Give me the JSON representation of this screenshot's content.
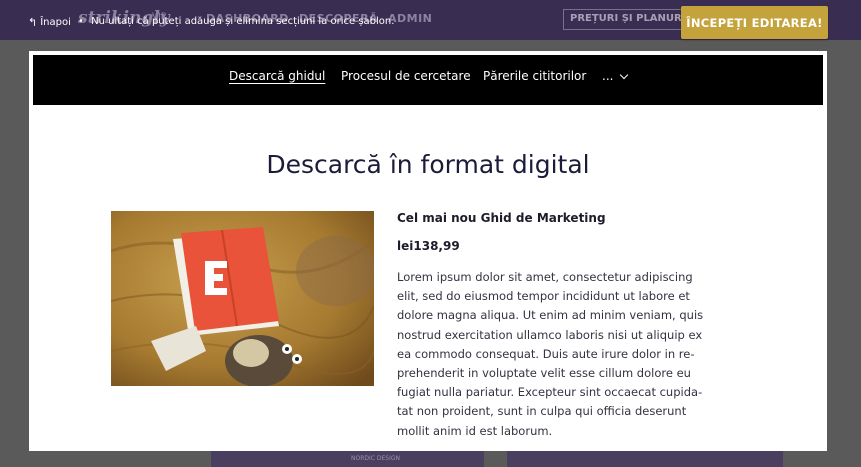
{
  "background": {
    "logo": "strikingly",
    "vip_badge": "VIP",
    "nav": [
      "DASHBOARD",
      "DESCOPERĂ",
      "ADMIN"
    ],
    "pricing_label": "PREȚURI ȘI PLANURI",
    "card_caption": "NORDIC DESIGN"
  },
  "editor_bar": {
    "back_label": "Înapoi",
    "separator": "•",
    "hint": "Nu uitați că puteți adăuga și elimina secțiuni la orice șablon.",
    "start_button": "ÎNCEPEȚI EDITAREA!"
  },
  "preview": {
    "nav": {
      "items": [
        "Descarcă ghidul",
        "Procesul de cercetare",
        "Părerile cititorilor",
        "..."
      ]
    },
    "section_title": "Descarcă în format digital",
    "product": {
      "title": "Cel mai nou Ghid de Marketing",
      "price": "lei138,99",
      "description": "Lorem ipsum dolor sit amet, consectetur adipiscing elit, sed do eiusmod tempor incididunt ut labore et dolore magna aliqua. Ut enim ad minim veniam, quis nostrud exercitation ullamco laboris nisi ut aliquip ex ea commodo consequat. Duis aute irure dolor in re-prehenderit in voluptate velit esse cillum dolore eu fugiat nulla pariatur. Excepteur sint occaecat cupida-tat non proident, sunt in culpa qui officia deserunt mollit anim id est laborum.",
      "book_letter": "E"
    }
  },
  "colors": {
    "accent_button": "#c5a33c",
    "topbar": "#3a2d52",
    "preview_nav": "#000000",
    "title": "#1c1c3a",
    "book_red": "#e8533a"
  }
}
